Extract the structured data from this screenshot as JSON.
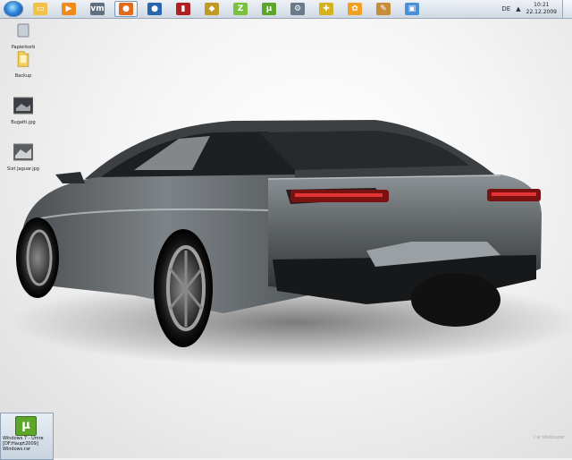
{
  "taskbar": {
    "items": [
      {
        "name": "explorer-icon",
        "glyph": "▭",
        "color": "#f0c24a",
        "active": false
      },
      {
        "name": "media-player-icon",
        "glyph": "▶",
        "color": "#f08a1c",
        "active": false
      },
      {
        "name": "vmware-icon",
        "glyph": "vm",
        "color": "#607080",
        "active": false
      },
      {
        "name": "firefox-icon",
        "glyph": "●",
        "color": "#e26a1b",
        "active": true
      },
      {
        "name": "thunderbird-icon",
        "glyph": "●",
        "color": "#2a66b0",
        "active": false
      },
      {
        "name": "flash-drive-icon",
        "glyph": "▮",
        "color": "#b02020",
        "active": false
      },
      {
        "name": "winamp-icon",
        "glyph": "◆",
        "color": "#c09a22",
        "active": false
      },
      {
        "name": "zip-archiver-icon",
        "glyph": "Z",
        "color": "#7cc040",
        "active": false
      },
      {
        "name": "utorrent-icon",
        "glyph": "µ",
        "color": "#5ea52c",
        "active": false
      },
      {
        "name": "network-tool-icon",
        "glyph": "⚙",
        "color": "#6a7a8a",
        "active": false
      },
      {
        "name": "puzzle-icon",
        "glyph": "✚",
        "color": "#d4b21e",
        "active": false
      },
      {
        "name": "icq-icon",
        "glyph": "✿",
        "color": "#f2a023",
        "active": false
      },
      {
        "name": "feather-icon",
        "glyph": "✎",
        "color": "#c88d3a",
        "active": false
      },
      {
        "name": "remote-desktop-icon",
        "glyph": "▣",
        "color": "#4a90d9",
        "active": false
      }
    ],
    "tray": {
      "language": "DE",
      "time": "10:21",
      "date": "22.12.2009"
    }
  },
  "desktop_icons": [
    {
      "name": "recycle-bin",
      "label": "Papierkorb",
      "type": "recycle"
    },
    {
      "name": "backup-folder",
      "label": "Backup",
      "type": "folder"
    },
    {
      "name": "image-file-1",
      "label": "Bugatti.jpg",
      "type": "image"
    },
    {
      "name": "image-file-2",
      "label": "Sixt Jaguar.jpg",
      "type": "image"
    }
  ],
  "torrent_tile": {
    "caption_line1": "Windows 7 - Umre",
    "caption_line2": "[DF:Haupt2009]",
    "caption_line3": "Windows.rar"
  },
  "watermark": "Car Wallpaper"
}
